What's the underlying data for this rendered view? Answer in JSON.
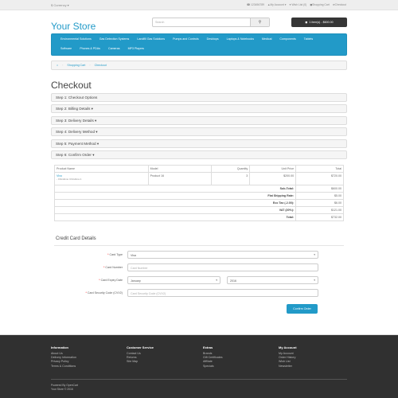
{
  "topbar": {
    "currency": "$ Currency ▾",
    "phone": "☎ 123456789",
    "my_account": "My Account ▾",
    "wish_list": "♥ Wish List (0)",
    "shopping_cart": "Shopping Cart",
    "checkout": "Checkout"
  },
  "header": {
    "logo": "Your Store",
    "search_placeholder": "Search",
    "cart_button": "1 item(s) - $600.00"
  },
  "menu": {
    "row1": [
      "Environmental Solutions",
      "Gas Detection Systems",
      "Landfill Gas Solutions",
      "Pumps and Controls",
      "Desktops",
      "Laptops & Notebooks",
      "Medical",
      "Components",
      "Tablets"
    ],
    "row2": [
      "Software",
      "Phones & PDAs",
      "Cameras",
      "MP3 Players"
    ]
  },
  "breadcrumb": [
    "Shopping Cart",
    "Checkout"
  ],
  "page_title": "Checkout",
  "steps": [
    "Step 1: Checkout Options",
    "Step 2: Billing Details ▾",
    "Step 3: Delivery Details ▾",
    "Step 4: Delivery Method ▾",
    "Step 5: Payment Method ▾",
    "Step 6: Confirm Order ▾"
  ],
  "order_table": {
    "headers": [
      "Product Name",
      "Model",
      "Quantity",
      "Unit Price",
      "Total"
    ],
    "item": {
      "name": "Vivo",
      "option": "- Chindima: Chindima 1",
      "model": "Product 16",
      "quantity": "3",
      "unit_price": "$200.00",
      "total": "$720.00"
    },
    "totals": [
      {
        "label": "Sub-Total:",
        "value": "$600.00"
      },
      {
        "label": "Flat Shipping Rate:",
        "value": "$5.00"
      },
      {
        "label": "Eco Tax (-2.00):",
        "value": "$6.00"
      },
      {
        "label": "VAT (20%):",
        "value": "$121.00"
      },
      {
        "label": "Total:",
        "value": "$732.00"
      }
    ]
  },
  "credit_card": {
    "title": "Credit Card Details",
    "card_type_label": "Card Type",
    "card_type_value": "Visa",
    "card_number_label": "Card Number",
    "card_number_placeholder": "Card Number",
    "expiry_label": "Card Expiry Date",
    "expiry_month": "January",
    "expiry_year": "2016",
    "cvv_label": "Card Security Code (CVV2)",
    "cvv_placeholder": "Card Security Code (CVV2)",
    "confirm_button": "Confirm Order"
  },
  "footer": {
    "information": {
      "title": "Information",
      "links": [
        "About Us",
        "Delivery Information",
        "Privacy Policy",
        "Terms & Conditions"
      ]
    },
    "customer_service": {
      "title": "Customer Service",
      "links": [
        "Contact Us",
        "Returns",
        "Site Map"
      ]
    },
    "extras": {
      "title": "Extras",
      "links": [
        "Brands",
        "Gift Certificates",
        "Affiliate",
        "Specials"
      ]
    },
    "my_account": {
      "title": "My Account",
      "links": [
        "My Account",
        "Order History",
        "Wish List",
        "Newsletter"
      ]
    },
    "powered_by": "Powered By OpenCart",
    "copyright": "Your Store © 2016"
  },
  "colors": {
    "accent": "#229ac8",
    "footer_bg": "#303030",
    "cart_button": "#363636"
  }
}
